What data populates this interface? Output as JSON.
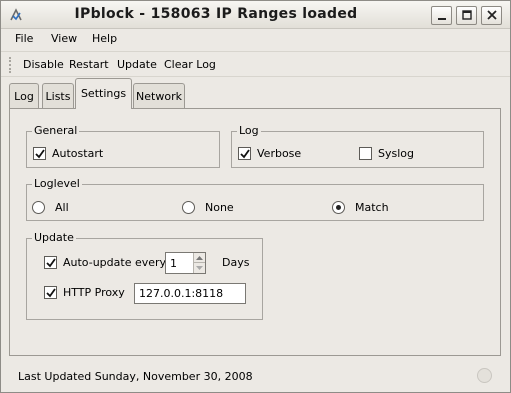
{
  "window": {
    "title": "IPblock - 158063 IP Ranges loaded"
  },
  "menu": {
    "file": "File",
    "view": "View",
    "help": "Help"
  },
  "toolbar": {
    "disable": "Disable",
    "restart": "Restart",
    "update": "Update",
    "clear_log": "Clear Log"
  },
  "tabs": [
    {
      "label": "Log",
      "active": false
    },
    {
      "label": "Lists",
      "active": false
    },
    {
      "label": "Settings",
      "active": true
    },
    {
      "label": "Network",
      "active": false
    }
  ],
  "settings": {
    "general": {
      "title": "General",
      "autostart": {
        "label": "Autostart",
        "checked": true
      }
    },
    "log": {
      "title": "Log",
      "verbose": {
        "label": "Verbose",
        "checked": true
      },
      "syslog": {
        "label": "Syslog",
        "checked": false
      }
    },
    "loglevel": {
      "title": "Loglevel",
      "options": [
        {
          "label": "All",
          "selected": false
        },
        {
          "label": "None",
          "selected": false
        },
        {
          "label": "Match",
          "selected": true
        }
      ]
    },
    "update": {
      "title": "Update",
      "auto_update": {
        "label": "Auto-update every",
        "checked": true,
        "value": "1",
        "unit": "Days"
      },
      "http_proxy": {
        "label": "HTTP Proxy",
        "checked": true,
        "value": "127.0.0.1:8118"
      }
    }
  },
  "status": {
    "text": "Last Updated Sunday, November 30, 2008"
  }
}
